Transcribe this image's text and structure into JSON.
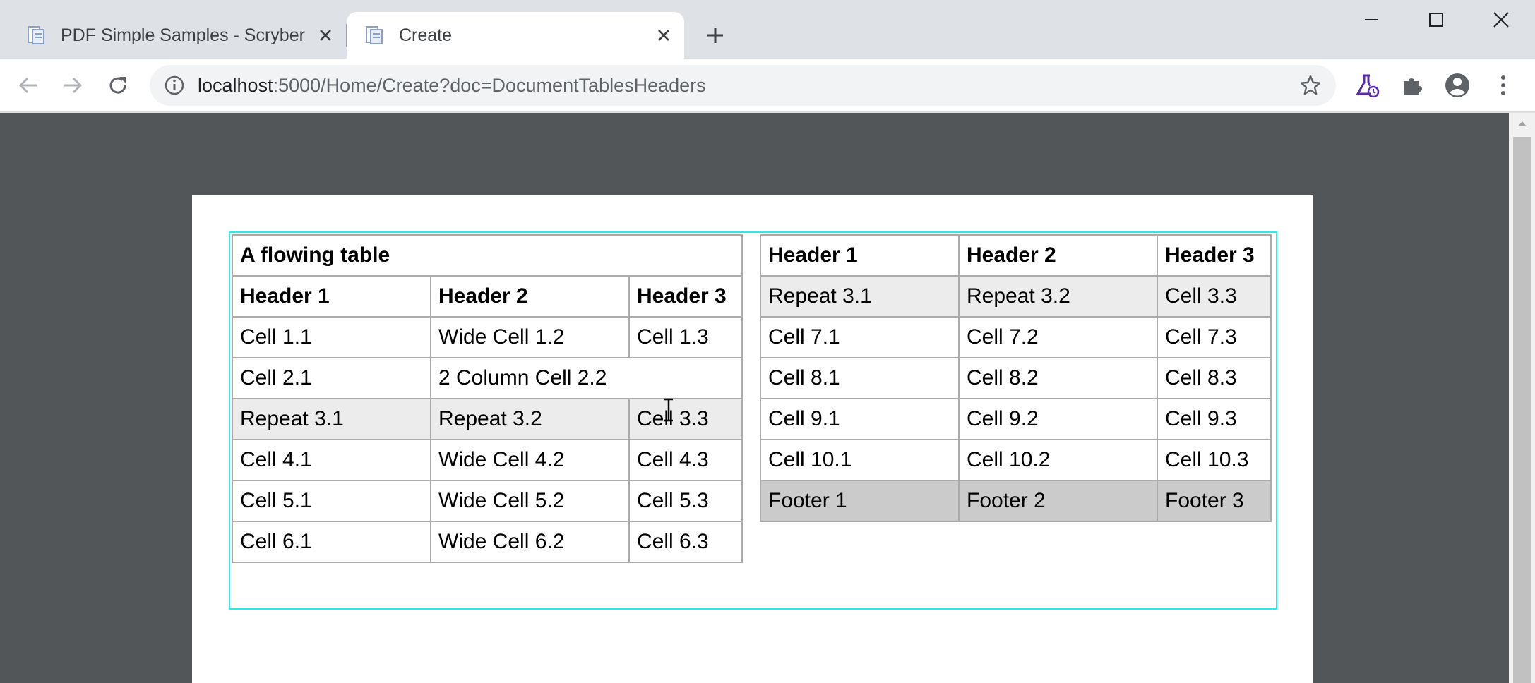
{
  "browser": {
    "tabs": [
      {
        "title": "PDF Simple Samples - Scryber",
        "active": false,
        "icon": "document-icon"
      },
      {
        "title": "Create",
        "active": true,
        "icon": "document-icon"
      }
    ],
    "address": {
      "host": "localhost",
      "path": ":5000/Home/Create?doc=DocumentTablesHeaders"
    }
  },
  "document": {
    "left_table": {
      "caption": "A flowing table",
      "headers": [
        "Header 1",
        "Header 2",
        "Header 3"
      ],
      "row1": [
        "Cell 1.1",
        "Wide Cell 1.2",
        "Cell 1.3"
      ],
      "row2": [
        "Cell 2.1",
        "2 Column Cell 2.2"
      ],
      "repeat": [
        "Repeat 3.1",
        "Repeat 3.2",
        "Cell 3.3"
      ],
      "row4": [
        "Cell 4.1",
        "Wide Cell 4.2",
        "Cell 4.3"
      ],
      "row5": [
        "Cell 5.1",
        "Wide Cell 5.2",
        "Cell 5.3"
      ],
      "row6": [
        "Cell 6.1",
        "Wide Cell 6.2",
        "Cell 6.3"
      ]
    },
    "right_table": {
      "headers": [
        "Header 1",
        "Header 2",
        "Header 3"
      ],
      "repeat": [
        "Repeat 3.1",
        "Repeat 3.2",
        "Cell 3.3"
      ],
      "row7": [
        "Cell 7.1",
        "Cell 7.2",
        "Cell 7.3"
      ],
      "row8": [
        "Cell 8.1",
        "Cell 8.2",
        "Cell 8.3"
      ],
      "row9": [
        "Cell 9.1",
        "Cell 9.2",
        "Cell 9.3"
      ],
      "row10": [
        "Cell 10.1",
        "Cell 10.2",
        "Cell 10.3"
      ],
      "footer": [
        "Footer 1",
        "Footer 2",
        "Footer 3"
      ]
    }
  },
  "colors": {
    "viewer_background": "#525659",
    "frame_border": "#2ee9ea",
    "repeat_row": "#ececec",
    "footer_row": "#cbcbcb",
    "cell_border": "#ababab"
  }
}
